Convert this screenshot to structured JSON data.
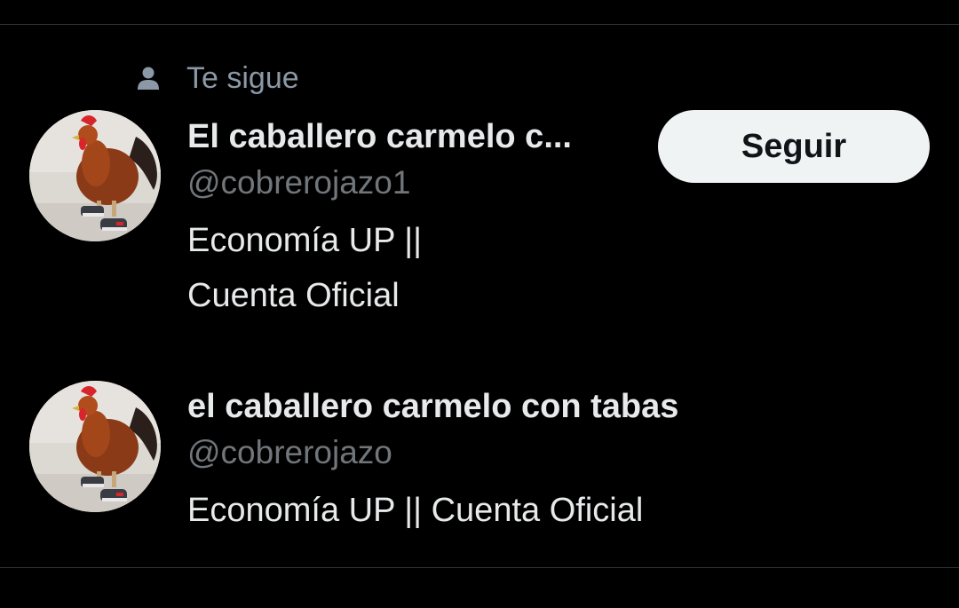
{
  "users": [
    {
      "social_context": "Te sigue",
      "social_context_icon": "person-icon",
      "avatar_icon": "rooster-avatar",
      "display_name": "El caballero carmelo c...",
      "handle": "@cobrerojazo1",
      "bio": "Economía UP || Cuenta Oficial",
      "follow_label": "Seguir"
    },
    {
      "avatar_icon": "rooster-avatar",
      "display_name": "el caballero carmelo con tabas",
      "handle": "@cobrerojazo",
      "bio": "Economía UP || Cuenta Oficial"
    }
  ],
  "colors": {
    "background": "#000000",
    "divider": "#2f3336",
    "primary_text": "#e7e9ea",
    "secondary_text": "#71767b",
    "button_bg": "#eff3f4",
    "button_text": "#0f1419"
  }
}
